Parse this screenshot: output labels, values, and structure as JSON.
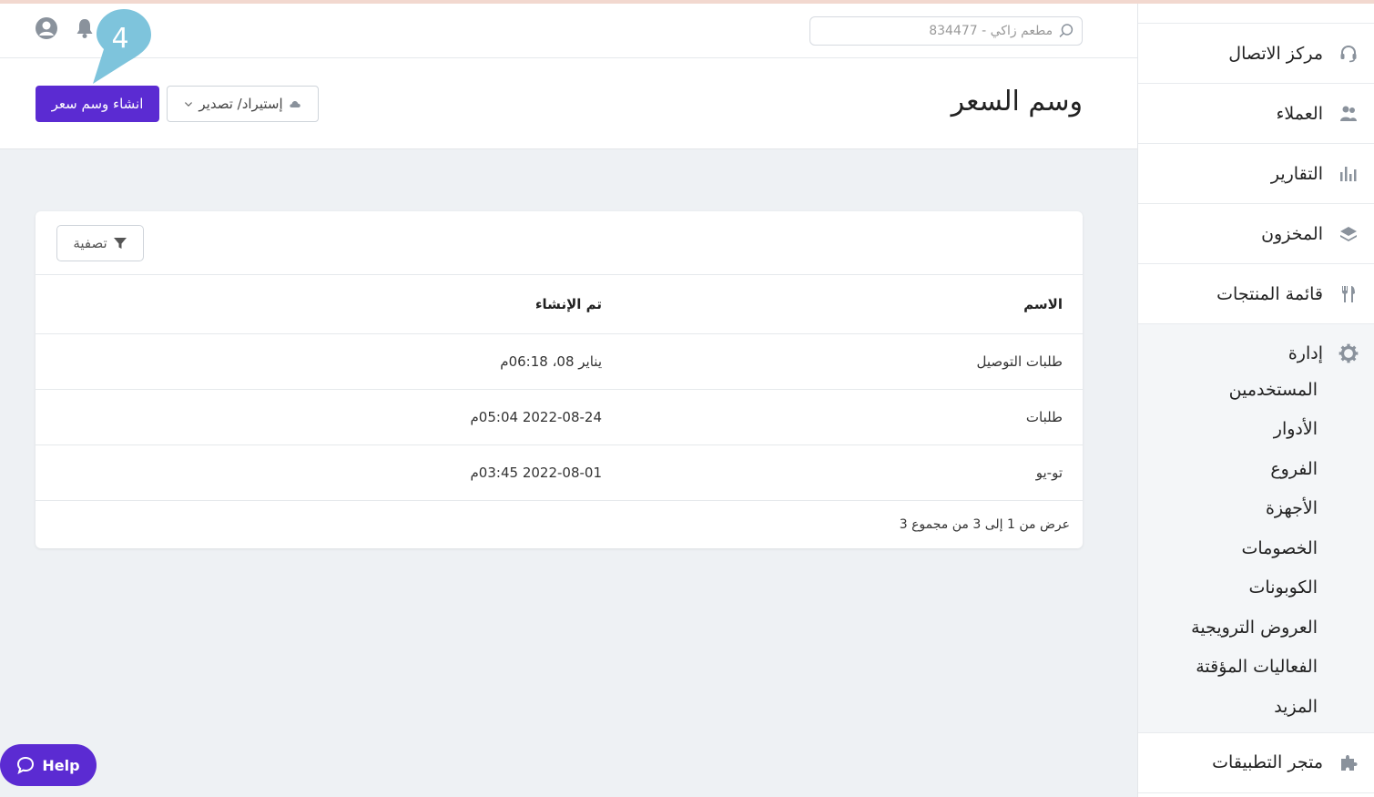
{
  "header": {
    "search_value": "مطعم زاكي - 834477"
  },
  "page": {
    "title": "وسم السعر",
    "create_label": "انشاء وسم سعر",
    "import_export_label": "إستيراد/ تصدير"
  },
  "marker": {
    "number": "4",
    "color": "#7ec4dc"
  },
  "table": {
    "filter_label": "تصفية",
    "columns": [
      "الاسم",
      "تم الإنشاء"
    ],
    "rows": [
      {
        "name": "طلبات التوصيل",
        "created": "يناير 08، 06:18م"
      },
      {
        "name": "طلبات",
        "created": "2022-08-24 05:04م"
      },
      {
        "name": "تو-يو",
        "created": "2022-08-01 03:45م"
      }
    ],
    "pagination": "عرض من 1 إلى 3 من مجموع 3"
  },
  "sidebar": {
    "items": [
      {
        "label": "مركز الاتصال",
        "icon": "headset-icon"
      },
      {
        "label": "العملاء",
        "icon": "customers-icon"
      },
      {
        "label": "التقارير",
        "icon": "bar-chart-icon"
      },
      {
        "label": "المخزون",
        "icon": "layers-icon"
      },
      {
        "label": "قائمة المنتجات",
        "icon": "fork-knife-icon"
      }
    ],
    "admin": {
      "label": "إدارة",
      "icon": "gear-icon",
      "sub_items": [
        "المستخدمين",
        "الأدوار",
        "الفروع",
        "الأجهزة",
        "الخصومات",
        "الكوبونات",
        "العروض الترويجية",
        "الفعاليات المؤقتة",
        "المزيد"
      ]
    },
    "app_store": {
      "label": "متجر التطبيقات",
      "icon": "puzzle-icon"
    }
  },
  "help": {
    "label": "Help"
  },
  "colors": {
    "accent": "#5b2bd2",
    "icon_gray": "#8a929c"
  }
}
